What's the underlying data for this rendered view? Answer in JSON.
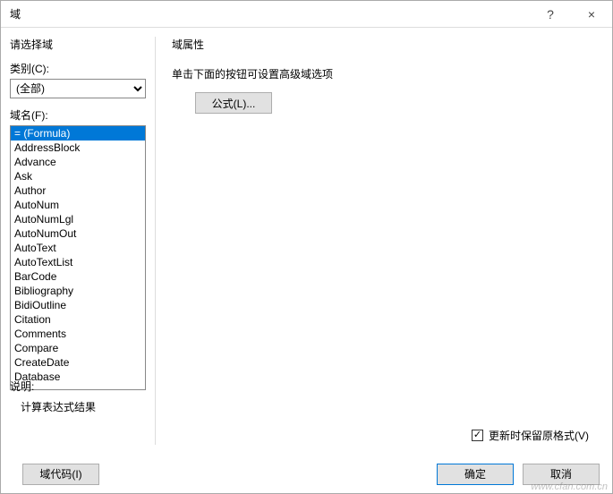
{
  "window": {
    "title": "域",
    "help": "?",
    "close": "×"
  },
  "left": {
    "select_field_label": "请选择域",
    "category_label": "类别(C):",
    "category_selected": "(全部)",
    "fieldname_label": "域名(F):",
    "fields": [
      "= (Formula)",
      "AddressBlock",
      "Advance",
      "Ask",
      "Author",
      "AutoNum",
      "AutoNumLgl",
      "AutoNumOut",
      "AutoText",
      "AutoTextList",
      "BarCode",
      "Bibliography",
      "BidiOutline",
      "Citation",
      "Comments",
      "Compare",
      "CreateDate",
      "Database"
    ],
    "selected_index": 0
  },
  "right": {
    "props_label": "域属性",
    "hint": "单击下面的按钮可设置高级域选项",
    "formula_btn": "公式(L)...",
    "preserve_label": "更新时保留原格式(V)",
    "preserve_checked": true
  },
  "bottom": {
    "desc_label": "说明:",
    "desc_text": "计算表达式结果",
    "field_codes_btn": "域代码(I)",
    "ok_btn": "确定",
    "cancel_btn": "取消"
  },
  "watermark": "www.cfan.com.cn"
}
